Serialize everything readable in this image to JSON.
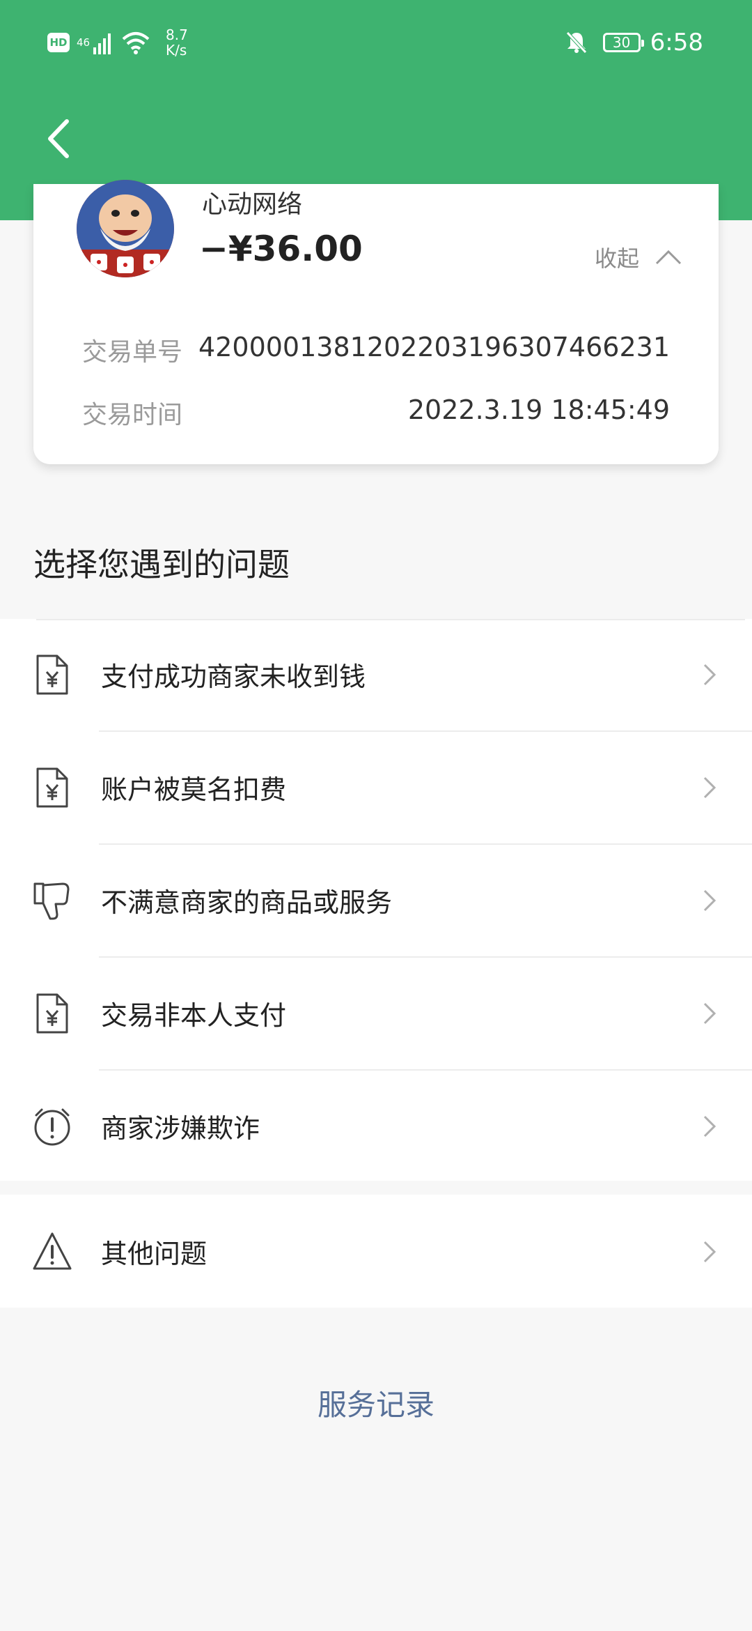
{
  "status_bar": {
    "hd": "HD",
    "network": "46",
    "speed_value": "8.7",
    "speed_unit": "K/s",
    "battery": "30",
    "time": "6:58"
  },
  "colors": {
    "header": "#3eb370",
    "link": "#566f98"
  },
  "transaction": {
    "merchant": "心动网络",
    "amount": "−¥36.00",
    "collapse_label": "收起",
    "order_label": "交易单号",
    "order_value": "4200001381202203196307466231",
    "time_label": "交易时间",
    "time_value": "2022.3.19 18:45:49"
  },
  "section_title": "选择您遇到的问题",
  "issues": [
    {
      "label": "支付成功商家未收到钱",
      "icon": "receipt-yen-icon"
    },
    {
      "label": "账户被莫名扣费",
      "icon": "receipt-yen-icon"
    },
    {
      "label": "不满意商家的商品或服务",
      "icon": "thumbs-down-icon"
    },
    {
      "label": "交易非本人支付",
      "icon": "receipt-yen-icon"
    },
    {
      "label": "商家涉嫌欺诈",
      "icon": "alarm-alert-icon"
    }
  ],
  "other_issue": {
    "label": "其他问题",
    "icon": "warning-triangle-icon"
  },
  "service_record": "服务记录"
}
